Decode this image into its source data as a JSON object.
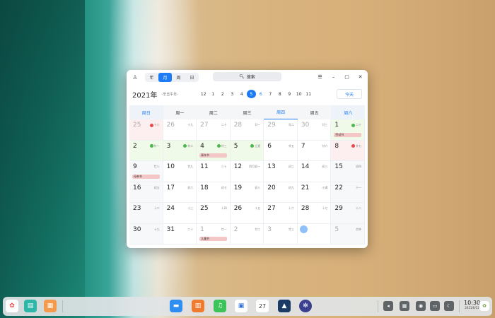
{
  "window": {
    "view_tabs": [
      "年",
      "月",
      "周",
      "日"
    ],
    "active_view": 1,
    "search_label": "搜索",
    "year": "2021年",
    "lunar_year": "-辛丑牛年-",
    "months": [
      "12",
      "1",
      "2",
      "3",
      "4",
      "5",
      "6",
      "7",
      "8",
      "9",
      "10",
      "11"
    ],
    "active_month_index": 5,
    "today_button": "今天",
    "weekdays": [
      "周日",
      "周一",
      "周二",
      "周三",
      "周四",
      "周五",
      "周六"
    ]
  },
  "calendar_rows": [
    [
      {
        "d": "25",
        "l": "十八",
        "dim": true,
        "badge": "work",
        "bg": "red"
      },
      {
        "d": "26",
        "l": "十九",
        "dim": true
      },
      {
        "d": "27",
        "l": "二十",
        "dim": true
      },
      {
        "d": "28",
        "l": "廿一",
        "dim": true
      },
      {
        "d": "29",
        "l": "廿二",
        "dim": true
      },
      {
        "d": "30",
        "l": "廿三",
        "dim": true
      },
      {
        "d": "1",
        "l": "二十",
        "badge": "rest",
        "bg": "green",
        "event": "劳动节"
      }
    ],
    [
      {
        "d": "2",
        "l": "廿一",
        "badge": "rest",
        "bg": "green"
      },
      {
        "d": "3",
        "l": "廿二",
        "badge": "rest",
        "bg": "green"
      },
      {
        "d": "4",
        "l": "廿三",
        "badge": "rest",
        "bg": "green",
        "event": "青年节"
      },
      {
        "d": "5",
        "l": "立夏",
        "badge": "rest",
        "bg": "green"
      },
      {
        "d": "6",
        "l": "廿五"
      },
      {
        "d": "7",
        "l": "廿六"
      },
      {
        "d": "8",
        "l": "廿七",
        "badge": "work",
        "bg": "red"
      }
    ],
    [
      {
        "d": "9",
        "l": "廿八",
        "event": "母亲节"
      },
      {
        "d": "10",
        "l": "廿九"
      },
      {
        "d": "11",
        "l": "三十"
      },
      {
        "d": "12",
        "l": "四月初一"
      },
      {
        "d": "13",
        "l": "初二"
      },
      {
        "d": "14",
        "l": "初三"
      },
      {
        "d": "15",
        "l": "初四"
      }
    ],
    [
      {
        "d": "16",
        "l": "初五"
      },
      {
        "d": "17",
        "l": "初六"
      },
      {
        "d": "18",
        "l": "初七"
      },
      {
        "d": "19",
        "l": "初八"
      },
      {
        "d": "20",
        "l": "初九"
      },
      {
        "d": "21",
        "l": "小满"
      },
      {
        "d": "22",
        "l": "十一"
      }
    ],
    [
      {
        "d": "23",
        "l": "十二"
      },
      {
        "d": "24",
        "l": "十三"
      },
      {
        "d": "25",
        "l": "十四"
      },
      {
        "d": "26",
        "l": "十五"
      },
      {
        "d": "27",
        "l": "十六"
      },
      {
        "d": "28",
        "l": "十七"
      },
      {
        "d": "29",
        "l": "十八"
      }
    ],
    [
      {
        "d": "30",
        "l": "十九"
      },
      {
        "d": "31",
        "l": "二十"
      },
      {
        "d": "1",
        "l": "廿一",
        "dim": true,
        "event": "儿童节"
      },
      {
        "d": "2",
        "l": "廿二",
        "dim": true
      },
      {
        "d": "3",
        "l": "廿三",
        "dim": true
      },
      {
        "d": "",
        "l": "",
        "today": true
      },
      {
        "d": "5",
        "l": "芒种",
        "dim": true
      }
    ]
  ],
  "dock": {
    "time": "10:30",
    "date": "2021/6/12"
  }
}
